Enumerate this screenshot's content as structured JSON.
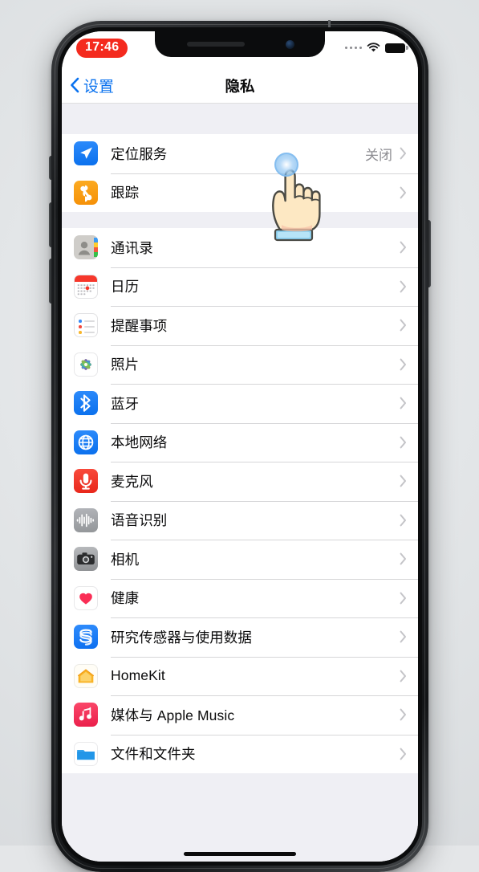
{
  "device": {
    "home_indicator": "home-indicator"
  },
  "status_bar": {
    "time": "17:46",
    "recording_badge": true,
    "signal_icon": "signal-dots-icon",
    "wifi_icon": "wifi-icon",
    "battery_icon": "battery-icon"
  },
  "nav": {
    "back_label": "设置",
    "back_icon": "chevron-left-icon",
    "title": "隐私"
  },
  "sections": [
    {
      "rows": [
        {
          "label": "定位服务",
          "value": "关闭",
          "icon": "location-services-icon"
        },
        {
          "label": "跟踪",
          "value": "",
          "icon": "tracking-icon"
        }
      ]
    },
    {
      "rows": [
        {
          "label": "通讯录",
          "value": "",
          "icon": "contacts-icon"
        },
        {
          "label": "日历",
          "value": "",
          "icon": "calendar-icon"
        },
        {
          "label": "提醒事项",
          "value": "",
          "icon": "reminders-icon"
        },
        {
          "label": "照片",
          "value": "",
          "icon": "photos-icon"
        },
        {
          "label": "蓝牙",
          "value": "",
          "icon": "bluetooth-icon"
        },
        {
          "label": "本地网络",
          "value": "",
          "icon": "local-network-icon"
        },
        {
          "label": "麦克风",
          "value": "",
          "icon": "microphone-icon"
        },
        {
          "label": "语音识别",
          "value": "",
          "icon": "speech-recognition-icon"
        },
        {
          "label": "相机",
          "value": "",
          "icon": "camera-icon"
        },
        {
          "label": "健康",
          "value": "",
          "icon": "health-icon"
        },
        {
          "label": "研究传感器与使用数据",
          "value": "",
          "icon": "research-sensor-icon"
        },
        {
          "label": "HomeKit",
          "value": "",
          "icon": "homekit-icon"
        },
        {
          "label": "媒体与 Apple Music",
          "value": "",
          "icon": "apple-music-icon"
        },
        {
          "label": "文件和文件夹",
          "value": "",
          "icon": "files-folders-icon"
        }
      ]
    }
  ],
  "cursor": {
    "type": "pointing-hand-cursor",
    "tap_indicator": "tap-ripple"
  },
  "colors": {
    "accent_blue": "#0a72ef",
    "record_red": "#f42a1e",
    "group_background": "#efeff4",
    "row_background": "#ffffff",
    "value_gray": "#8d8d92"
  }
}
